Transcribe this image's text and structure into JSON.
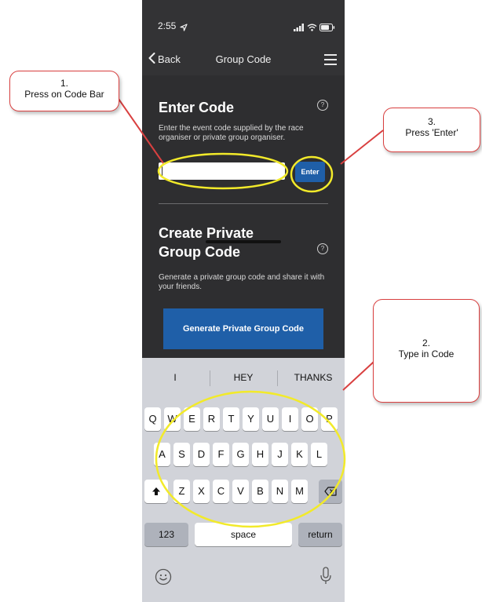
{
  "status_bar": {
    "time": "2:55"
  },
  "nav": {
    "back_label": "Back",
    "title": "Group Code"
  },
  "enter_code": {
    "title": "Enter Code",
    "description": "Enter the event code supplied by the race organiser or private group organiser.",
    "input_value": "",
    "enter_button_label": "Enter",
    "help_symbol": "?"
  },
  "private_code": {
    "title_line1": "Create Private",
    "title_line2": "Group Code",
    "description": "Generate a private group code and share it with your friends.",
    "generate_button_label": "Generate Private Group Code",
    "help_symbol": "?"
  },
  "keyboard": {
    "suggestions": [
      "I",
      "HEY",
      "THANKS"
    ],
    "row1": [
      "Q",
      "W",
      "E",
      "R",
      "T",
      "Y",
      "U",
      "I",
      "O",
      "P"
    ],
    "row2": [
      "A",
      "S",
      "D",
      "F",
      "G",
      "H",
      "J",
      "K",
      "L"
    ],
    "row3": [
      "Z",
      "X",
      "C",
      "V",
      "B",
      "N",
      "M"
    ],
    "numbers_label": "123",
    "space_label": "space",
    "return_label": "return"
  },
  "callouts": {
    "step1_number": "1.",
    "step1_text": "Press on Code Bar",
    "step2_number": "2.",
    "step2_text": "Type in Code",
    "step3_number": "3.",
    "step3_text": "Press 'Enter'"
  },
  "colors": {
    "app_background": "#2e2e30",
    "button_blue": "#1f5fa8",
    "highlight_yellow": "#f2ea2a",
    "callout_border": "#d94040",
    "keyboard_background": "#d1d3d9"
  },
  "icons": {
    "back": "chevron-left-icon",
    "menu": "hamburger-menu-icon",
    "help": "question-circle-icon",
    "shift": "shift-icon",
    "delete": "backspace-icon",
    "emoji": "emoji-icon",
    "mic": "microphone-icon"
  }
}
